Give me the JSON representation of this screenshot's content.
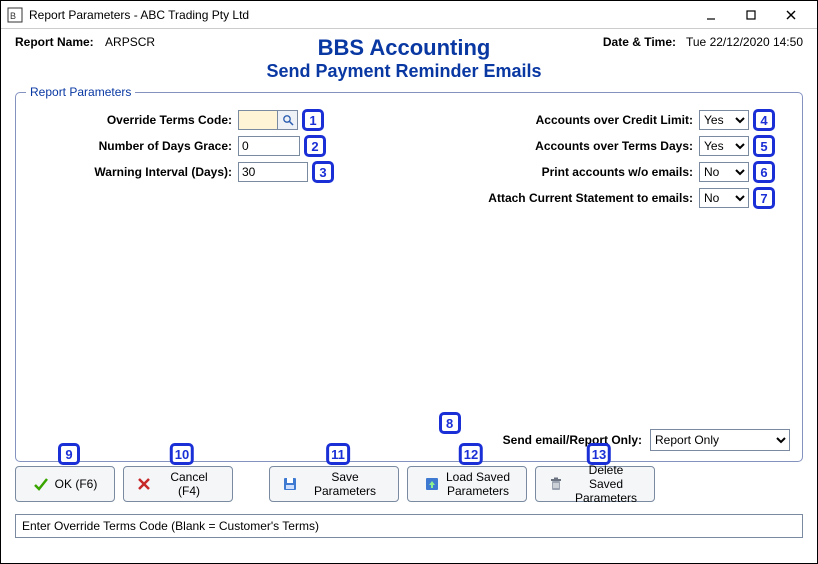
{
  "window": {
    "title": "Report Parameters - ABC Trading Pty Ltd"
  },
  "header": {
    "report_name_label": "Report Name:",
    "report_name_value": "ARPSCR",
    "app_title": "BBS Accounting",
    "app_subtitle": "Send Payment Reminder Emails",
    "datetime_label": "Date & Time:",
    "datetime_value": "Tue 22/12/2020 14:50"
  },
  "fieldset": {
    "legend": "Report Parameters",
    "left": {
      "override_terms_label": "Override Terms Code:",
      "override_terms_value": "",
      "days_grace_label": "Number of Days Grace:",
      "days_grace_value": "0",
      "warning_interval_label": "Warning Interval (Days):",
      "warning_interval_value": "30"
    },
    "right": {
      "over_credit_label": "Accounts over Credit Limit:",
      "over_credit_value": "Yes",
      "over_terms_label": "Accounts over Terms Days:",
      "over_terms_value": "Yes",
      "print_wo_emails_label": "Print accounts w/o emails:",
      "print_wo_emails_value": "No",
      "attach_stmt_label": "Attach Current Statement to emails:",
      "attach_stmt_value": "No"
    },
    "send_mode_label": "Send email/Report Only:",
    "send_mode_value": "Report Only"
  },
  "markers": {
    "m1": "1",
    "m2": "2",
    "m3": "3",
    "m4": "4",
    "m5": "5",
    "m6": "6",
    "m7": "7",
    "m8": "8",
    "m9": "9",
    "m10": "10",
    "m11": "11",
    "m12": "12",
    "m13": "13"
  },
  "buttons": {
    "ok": "OK (F6)",
    "cancel": "Cancel (F4)",
    "save_params": "Save Parameters",
    "load_params": "Load Saved\nParameters",
    "delete_params": "Delete Saved\nParameters"
  },
  "statusbar": {
    "text": "Enter Override Terms Code (Blank = Customer's Terms)"
  }
}
